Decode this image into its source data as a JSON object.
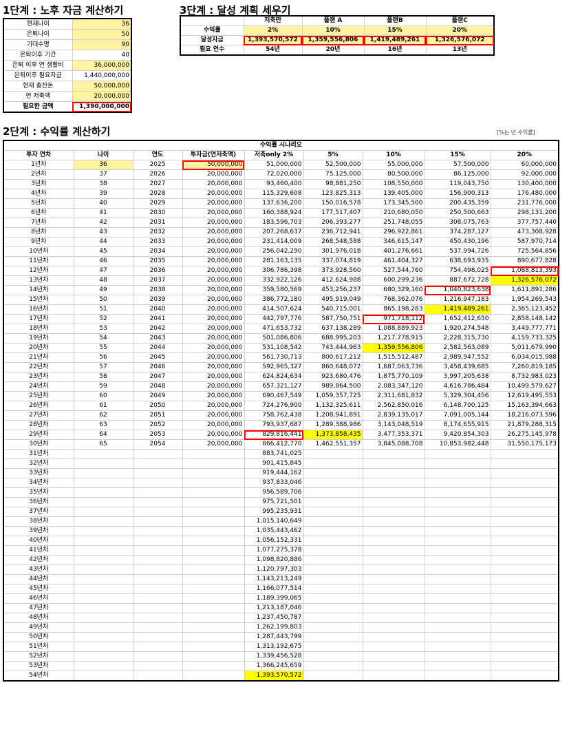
{
  "step1": {
    "title": "1단계 : 노후 자금 계산하기",
    "rows": [
      {
        "label": "현재나이",
        "value": "36",
        "fill": "y"
      },
      {
        "label": "은퇴나이",
        "value": "50",
        "fill": "y"
      },
      {
        "label": "기대수명",
        "value": "90",
        "fill": "y"
      },
      {
        "label": "은퇴이후 기간",
        "value": "40",
        "fill": ""
      },
      {
        "label": "은퇴 이후 연 생활비",
        "value": "36,000,000",
        "fill": "y"
      },
      {
        "label": "은퇴이후 필요자금",
        "value": "1,440,000,000",
        "fill": ""
      },
      {
        "label": "현재 총잔돈",
        "value": "50,000,000",
        "fill": "y"
      },
      {
        "label": "연 저축액",
        "value": "20,000,000",
        "fill": "y"
      },
      {
        "label": "필요한 금액",
        "value": "1,390,000,000",
        "fill": "red",
        "bold": true
      }
    ]
  },
  "step3": {
    "title": "3단계 : 달성 계획 세우기",
    "headers": [
      "",
      "저축만",
      "플랜 A",
      "플랜B",
      "플랜C"
    ],
    "rows": [
      {
        "label": "수익률",
        "values": [
          "2%",
          "10%",
          "15%",
          "20%"
        ]
      },
      {
        "label": "달성자금",
        "values": [
          "1,393,570,572",
          "1,359,556,806",
          "1,419,489,261",
          "1,326,576,072"
        ]
      },
      {
        "label": "필요 연수",
        "values": [
          "54년",
          "20년",
          "16년",
          "13년"
        ]
      }
    ]
  },
  "step2": {
    "title": "2단계 : 수익률 계산하기",
    "note": "[%는 년 수익률]",
    "scenario_header": "수익률 시나리오",
    "headers": [
      "투자 연차",
      "나이",
      "연도",
      "투자금(연저축액)",
      "저축only 2%",
      "5%",
      "10%",
      "15%",
      "20%"
    ],
    "rows": [
      [
        "1년차",
        "36",
        "2025",
        "50,000,000",
        "51,000,000",
        "52,500,000",
        "55,000,000",
        "57,500,000",
        "60,000,000"
      ],
      [
        "2년차",
        "37",
        "2026",
        "20,000,000",
        "72,020,000",
        "75,125,000",
        "80,500,000",
        "86,125,000",
        "92,000,000"
      ],
      [
        "3년차",
        "38",
        "2027",
        "20,000,000",
        "93,460,400",
        "98,881,250",
        "108,550,000",
        "119,043,750",
        "130,400,000"
      ],
      [
        "4년차",
        "39",
        "2028",
        "20,000,000",
        "115,329,608",
        "123,825,313",
        "139,405,000",
        "156,900,313",
        "176,480,000"
      ],
      [
        "5년차",
        "40",
        "2029",
        "20,000,000",
        "137,636,200",
        "150,016,578",
        "173,345,500",
        "200,435,359",
        "231,776,000"
      ],
      [
        "6년차",
        "41",
        "2030",
        "20,000,000",
        "160,388,924",
        "177,517,407",
        "210,680,050",
        "250,500,663",
        "298,131,200"
      ],
      [
        "7년차",
        "42",
        "2031",
        "20,000,000",
        "183,596,703",
        "206,393,277",
        "251,748,055",
        "308,075,763",
        "377,757,440"
      ],
      [
        "8년차",
        "43",
        "2032",
        "20,000,000",
        "207,268,637",
        "236,712,941",
        "296,922,861",
        "374,287,127",
        "473,308,928"
      ],
      [
        "9년차",
        "44",
        "2033",
        "20,000,000",
        "231,414,009",
        "268,548,588",
        "346,615,147",
        "450,430,196",
        "587,970,714"
      ],
      [
        "10년차",
        "45",
        "2034",
        "20,000,000",
        "256,042,290",
        "301,976,018",
        "401,276,661",
        "537,994,726",
        "725,564,856"
      ],
      [
        "11년차",
        "46",
        "2035",
        "20,000,000",
        "281,163,135",
        "337,074,819",
        "461,404,327",
        "638,693,935",
        "890,677,828"
      ],
      [
        "12년차",
        "47",
        "2036",
        "20,000,000",
        "306,786,398",
        "373,928,560",
        "527,544,760",
        "754,498,025",
        "1,088,813,393"
      ],
      [
        "13년차",
        "48",
        "2037",
        "20,000,000",
        "332,922,126",
        "412,624,988",
        "600,299,236",
        "887,672,728",
        "1,326,576,072"
      ],
      [
        "14년차",
        "49",
        "2038",
        "20,000,000",
        "359,580,569",
        "453,256,237",
        "680,329,160",
        "1,040,823,638",
        "1,611,891,286"
      ],
      [
        "15년차",
        "50",
        "2039",
        "20,000,000",
        "386,772,180",
        "495,919,049",
        "768,362,076",
        "1,216,947,183",
        "1,954,269,543"
      ],
      [
        "16년차",
        "51",
        "2040",
        "20,000,000",
        "414,507,624",
        "540,715,001",
        "865,198,283",
        "1,419,489,261",
        "2,365,123,452"
      ],
      [
        "17년차",
        "52",
        "2041",
        "20,000,000",
        "442,797,776",
        "587,750,751",
        "971,718,112",
        "1,652,412,650",
        "2,858,148,142"
      ],
      [
        "18년차",
        "53",
        "2042",
        "20,000,000",
        "471,653,732",
        "637,138,289",
        "1,088,889,923",
        "1,920,274,548",
        "3,449,777,771"
      ],
      [
        "19년차",
        "54",
        "2043",
        "20,000,000",
        "501,086,806",
        "688,995,203",
        "1,217,778,915",
        "2,228,315,730",
        "4,159,733,325"
      ],
      [
        "20년차",
        "55",
        "2044",
        "20,000,000",
        "531,108,542",
        "743,444,963",
        "1,359,556,806",
        "2,582,563,089",
        "5,011,679,990"
      ],
      [
        "21년차",
        "56",
        "2045",
        "20,000,000",
        "561,730,713",
        "800,617,212",
        "1,515,512,487",
        "2,989,947,552",
        "6,034,015,988"
      ],
      [
        "22년차",
        "57",
        "2046",
        "20,000,000",
        "592,965,327",
        "860,648,072",
        "1,687,063,736",
        "3,458,439,685",
        "7,260,819,185"
      ],
      [
        "23년차",
        "58",
        "2047",
        "20,000,000",
        "624,824,634",
        "923,680,476",
        "1,875,770,109",
        "3,997,205,638",
        "8,732,983,023"
      ],
      [
        "24년차",
        "59",
        "2048",
        "20,000,000",
        "657,321,127",
        "989,864,500",
        "2,083,347,120",
        "4,616,786,484",
        "10,499,579,627"
      ],
      [
        "25년차",
        "60",
        "2049",
        "20,000,000",
        "690,467,549",
        "1,059,357,725",
        "2,311,681,832",
        "5,329,304,456",
        "12,619,495,553"
      ],
      [
        "26년차",
        "61",
        "2050",
        "20,000,000",
        "724,276,900",
        "1,132,325,611",
        "2,562,850,016",
        "6,148,700,125",
        "15,163,394,663"
      ],
      [
        "27년차",
        "62",
        "2051",
        "20,000,000",
        "758,762,438",
        "1,208,941,891",
        "2,839,135,017",
        "7,091,005,144",
        "18,216,073,596"
      ],
      [
        "28년차",
        "63",
        "2052",
        "20,000,000",
        "793,937,687",
        "1,289,388,986",
        "3,143,048,519",
        "8,174,655,915",
        "21,879,288,315"
      ],
      [
        "29년차",
        "64",
        "2053",
        "20,000,000",
        "829,816,441",
        "1,373,858,435",
        "3,477,353,371",
        "9,420,854,303",
        "26,275,145,978"
      ],
      [
        "30년차",
        "65",
        "2054",
        "20,000,000",
        "866,412,770",
        "1,462,551,357",
        "3,845,088,708",
        "10,853,982,448",
        "31,550,175,173"
      ],
      [
        "31년차",
        "",
        "",
        "",
        "883,741,025",
        "",
        "",
        "",
        ""
      ],
      [
        "32년차",
        "",
        "",
        "",
        "901,415,845",
        "",
        "",
        "",
        ""
      ],
      [
        "33년차",
        "",
        "",
        "",
        "919,444,162",
        "",
        "",
        "",
        ""
      ],
      [
        "34년차",
        "",
        "",
        "",
        "937,833,046",
        "",
        "",
        "",
        ""
      ],
      [
        "35년차",
        "",
        "",
        "",
        "956,589,706",
        "",
        "",
        "",
        ""
      ],
      [
        "36년차",
        "",
        "",
        "",
        "975,721,501",
        "",
        "",
        "",
        ""
      ],
      [
        "37년차",
        "",
        "",
        "",
        "995,235,931",
        "",
        "",
        "",
        ""
      ],
      [
        "38년차",
        "",
        "",
        "",
        "1,015,140,649",
        "",
        "",
        "",
        ""
      ],
      [
        "39년차",
        "",
        "",
        "",
        "1,035,443,462",
        "",
        "",
        "",
        ""
      ],
      [
        "40년차",
        "",
        "",
        "",
        "1,056,152,331",
        "",
        "",
        "",
        ""
      ],
      [
        "41년차",
        "",
        "",
        "",
        "1,077,275,378",
        "",
        "",
        "",
        ""
      ],
      [
        "42년차",
        "",
        "",
        "",
        "1,098,820,886",
        "",
        "",
        "",
        ""
      ],
      [
        "43년차",
        "",
        "",
        "",
        "1,120,797,303",
        "",
        "",
        "",
        ""
      ],
      [
        "44년차",
        "",
        "",
        "",
        "1,143,213,249",
        "",
        "",
        "",
        ""
      ],
      [
        "45년차",
        "",
        "",
        "",
        "1,166,077,514",
        "",
        "",
        "",
        ""
      ],
      [
        "46년차",
        "",
        "",
        "",
        "1,189,399,065",
        "",
        "",
        "",
        ""
      ],
      [
        "47년차",
        "",
        "",
        "",
        "1,213,187,046",
        "",
        "",
        "",
        ""
      ],
      [
        "48년차",
        "",
        "",
        "",
        "1,237,450,787",
        "",
        "",
        "",
        ""
      ],
      [
        "49년차",
        "",
        "",
        "",
        "1,262,199,803",
        "",
        "",
        "",
        ""
      ],
      [
        "50년차",
        "",
        "",
        "",
        "1,287,443,799",
        "",
        "",
        "",
        ""
      ],
      [
        "51년차",
        "",
        "",
        "",
        "1,313,192,675",
        "",
        "",
        "",
        ""
      ],
      [
        "52년차",
        "",
        "",
        "",
        "1,339,456,528",
        "",
        "",
        "",
        ""
      ],
      [
        "53년차",
        "",
        "",
        "",
        "1,366,245,659",
        "",
        "",
        "",
        ""
      ],
      [
        "54년차",
        "",
        "",
        "",
        "1,393,570,572",
        "",
        "",
        "",
        ""
      ]
    ]
  }
}
